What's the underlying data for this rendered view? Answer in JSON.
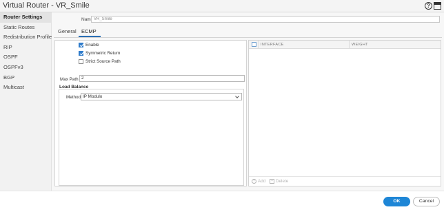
{
  "window": {
    "title": "Virtual Router - VR_Smile",
    "help_symbol": "?"
  },
  "sidebar": {
    "items": [
      {
        "label": "Router Settings",
        "active": true
      },
      {
        "label": "Static Routes"
      },
      {
        "label": "Redistribution Profile"
      },
      {
        "label": "RIP"
      },
      {
        "label": "OSPF"
      },
      {
        "label": "OSPFv3"
      },
      {
        "label": "BGP"
      },
      {
        "label": "Multicast"
      }
    ]
  },
  "form": {
    "name_label": "Name",
    "name_value": "VR_Smile"
  },
  "tabs": [
    {
      "label": "General"
    },
    {
      "label": "ECMP",
      "active": true
    }
  ],
  "ecmp": {
    "enable_label": "Enable",
    "enable_checked": true,
    "symmetric_label": "Symmetric Return",
    "symmetric_checked": true,
    "strict_label": "Strict Source Path",
    "strict_checked": false,
    "max_path_label": "Max Path",
    "max_path_value": "2",
    "load_balance_label": "Load Balance",
    "method_label": "Method",
    "method_value": "IP Modulo"
  },
  "interface_grid": {
    "columns": [
      "INTERFACE",
      "WEIGHT"
    ],
    "add_label": "Add",
    "delete_label": "Delete"
  },
  "buttons": {
    "ok": "OK",
    "cancel": "Cancel"
  },
  "colors": {
    "accent": "#1e86d6",
    "checkbox": "#2f7ccb",
    "tab_underline": "#2a6fb5"
  }
}
